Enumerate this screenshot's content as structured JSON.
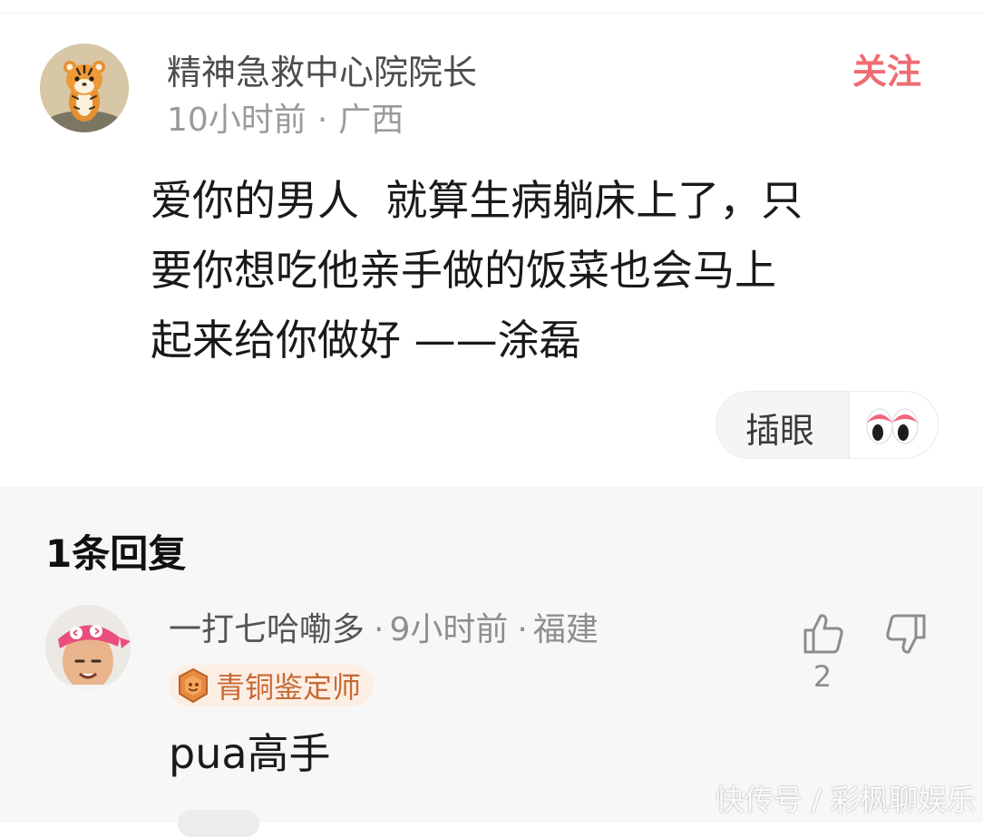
{
  "post": {
    "author": "精神急救中心院院长",
    "time": "10小时前",
    "separator": "·",
    "location": "广西",
    "follow_label": "关注",
    "lines": [
      "爱你的男人  就算生病躺床上了，只",
      "要你想吃他亲手做的饭菜也会马上",
      "起来给你做好 ——涂磊"
    ],
    "reaction_label": "插眼"
  },
  "replies": {
    "title": "1条回复",
    "items": [
      {
        "author": "一打七哈嘞多",
        "time": "9小时前",
        "location": "福建",
        "badge": "青铜鉴定师",
        "text": "pua高手",
        "likes": "2"
      }
    ]
  },
  "watermark": "快传号 / 彩枫聊娱乐",
  "colors": {
    "accent": "#f06b73",
    "badge_text": "#c56a35",
    "badge_bg": "#fdeee4"
  },
  "icons": [
    "tiger-avatar",
    "eyes-emoji-icon",
    "bronze-badge-icon",
    "thumbs-up-icon",
    "thumbs-down-icon"
  ]
}
